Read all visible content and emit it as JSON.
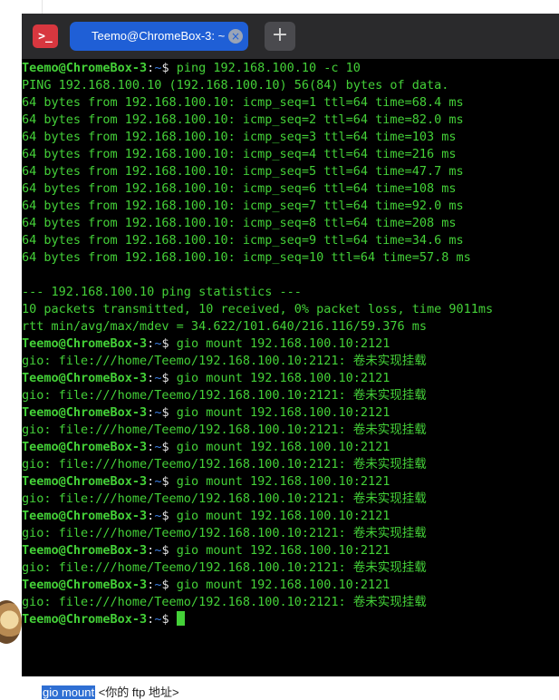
{
  "window": {
    "tab_title": "Teemo@ChromeBox-3: ~",
    "app_icon_glyph": ">_",
    "close_glyph": "×",
    "new_tab_glyph": "+"
  },
  "prompt": {
    "user_host": "Teemo@ChromeBox-3",
    "colon": ":",
    "path": "~",
    "dollar": "$ "
  },
  "terminal": {
    "ping_command": "ping 192.168.100.10 -c 10",
    "ping_header": "PING 192.168.100.10 (192.168.100.10) 56(84) bytes of data.",
    "ping_replies": [
      "64 bytes from 192.168.100.10: icmp_seq=1 ttl=64 time=68.4 ms",
      "64 bytes from 192.168.100.10: icmp_seq=2 ttl=64 time=82.0 ms",
      "64 bytes from 192.168.100.10: icmp_seq=3 ttl=64 time=103 ms",
      "64 bytes from 192.168.100.10: icmp_seq=4 ttl=64 time=216 ms",
      "64 bytes from 192.168.100.10: icmp_seq=5 ttl=64 time=47.7 ms",
      "64 bytes from 192.168.100.10: icmp_seq=6 ttl=64 time=108 ms",
      "64 bytes from 192.168.100.10: icmp_seq=7 ttl=64 time=92.0 ms",
      "64 bytes from 192.168.100.10: icmp_seq=8 ttl=64 time=208 ms",
      "64 bytes from 192.168.100.10: icmp_seq=9 ttl=64 time=34.6 ms",
      "64 bytes from 192.168.100.10: icmp_seq=10 ttl=64 time=57.8 ms"
    ],
    "stats_header": "--- 192.168.100.10 ping statistics ---",
    "stats_packets": "10 packets transmitted, 10 received, 0% packet loss, time 9011ms",
    "stats_rtt": "rtt min/avg/max/mdev = 34.622/101.640/216.116/59.376 ms",
    "gio_command": "gio mount 192.168.100.10:2121",
    "gio_error": "gio: file:///home/Teemo/192.168.100.10:2121: 卷未实现挂载",
    "gio_attempts": 8
  },
  "background_page": {
    "highlighted_text": "gio mount",
    "trailing_text": " <你的 ftp 地址>"
  },
  "colors": {
    "terminal_green": "#44d138",
    "prompt_path_blue": "#3c7de0",
    "tab_blue": "#1f5fd6",
    "titlebar": "#2a2a2c",
    "app_icon_red": "#d8373f"
  }
}
